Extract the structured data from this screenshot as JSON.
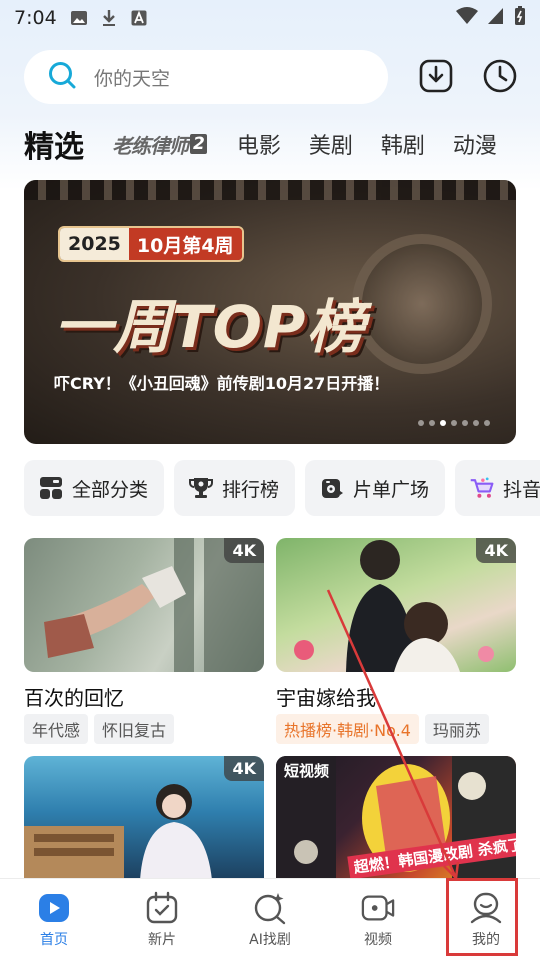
{
  "status_bar": {
    "time": "7:04"
  },
  "search": {
    "placeholder": "你的天空"
  },
  "tabs": [
    {
      "label": "精选",
      "active": true
    },
    {
      "label": "老练律师2",
      "logo": true
    },
    {
      "label": "电影"
    },
    {
      "label": "美剧"
    },
    {
      "label": "韩剧"
    },
    {
      "label": "动漫"
    }
  ],
  "banner": {
    "year": "2025",
    "week": "10月第4周",
    "title": "一周TOP榜",
    "subtitle": "吓CRY！《小丑回魂》前传剧10月27日开播！",
    "dots": 7,
    "active_dot": 2
  },
  "categories": [
    {
      "label": "全部分类",
      "icon": "grid-icon"
    },
    {
      "label": "排行榜",
      "icon": "trophy-icon"
    },
    {
      "label": "片单广场",
      "icon": "playlist-icon"
    },
    {
      "label": "抖音",
      "icon": "shopping-cart-icon"
    }
  ],
  "cards": [
    {
      "title": "百次的回忆",
      "badge": "4K",
      "tags": [
        "年代感",
        "怀旧复古"
      ]
    },
    {
      "title": "宇宙嫁给我",
      "badge": "4K",
      "tags": [
        "热播榜·韩剧·No.4",
        "玛丽苏"
      ],
      "hot_tag": 0
    },
    {
      "title": "",
      "badge": "4K",
      "tags": []
    },
    {
      "title": "",
      "badge": "",
      "overlay_top": "短视频",
      "overlay_text": "超燃！韩国漫改剧 杀疯了",
      "tags": []
    }
  ],
  "bottom_nav": [
    {
      "label": "首页",
      "icon": "home-play-icon",
      "active": true
    },
    {
      "label": "新片",
      "icon": "calendar-icon"
    },
    {
      "label": "AI找剧",
      "icon": "ai-search-icon"
    },
    {
      "label": "视频",
      "icon": "video-icon"
    },
    {
      "label": "我的",
      "icon": "profile-icon"
    }
  ],
  "colors": {
    "accent": "#2b7fe6",
    "annotation": "#d93a3a",
    "hot_tag": "#e8742a"
  }
}
